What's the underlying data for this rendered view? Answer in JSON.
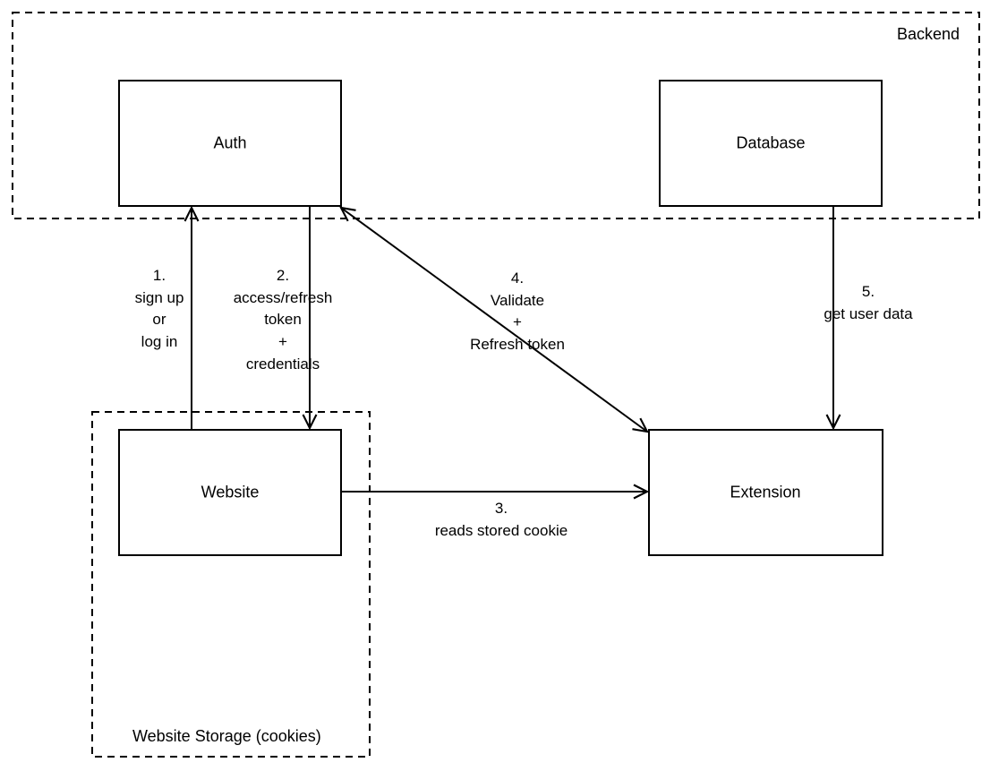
{
  "regions": {
    "backend": {
      "label": "Backend"
    },
    "website_storage": {
      "label": "Website Storage (cookies)"
    }
  },
  "nodes": {
    "auth": {
      "label": "Auth"
    },
    "database": {
      "label": "Database"
    },
    "website": {
      "label": "Website"
    },
    "extension": {
      "label": "Extension"
    }
  },
  "edges": {
    "e1": {
      "number": "1.",
      "l1": "sign up",
      "l2": "or",
      "l3": "log in"
    },
    "e2": {
      "number": "2.",
      "l1": "access/refresh",
      "l2": "token",
      "l3": "+",
      "l4": "credentials"
    },
    "e3": {
      "number": "3.",
      "l1": "reads stored cookie"
    },
    "e4": {
      "number": "4.",
      "l1": "Validate",
      "l2": "+",
      "l3": "Refresh token"
    },
    "e5": {
      "number": "5.",
      "l1": "get user data"
    }
  }
}
